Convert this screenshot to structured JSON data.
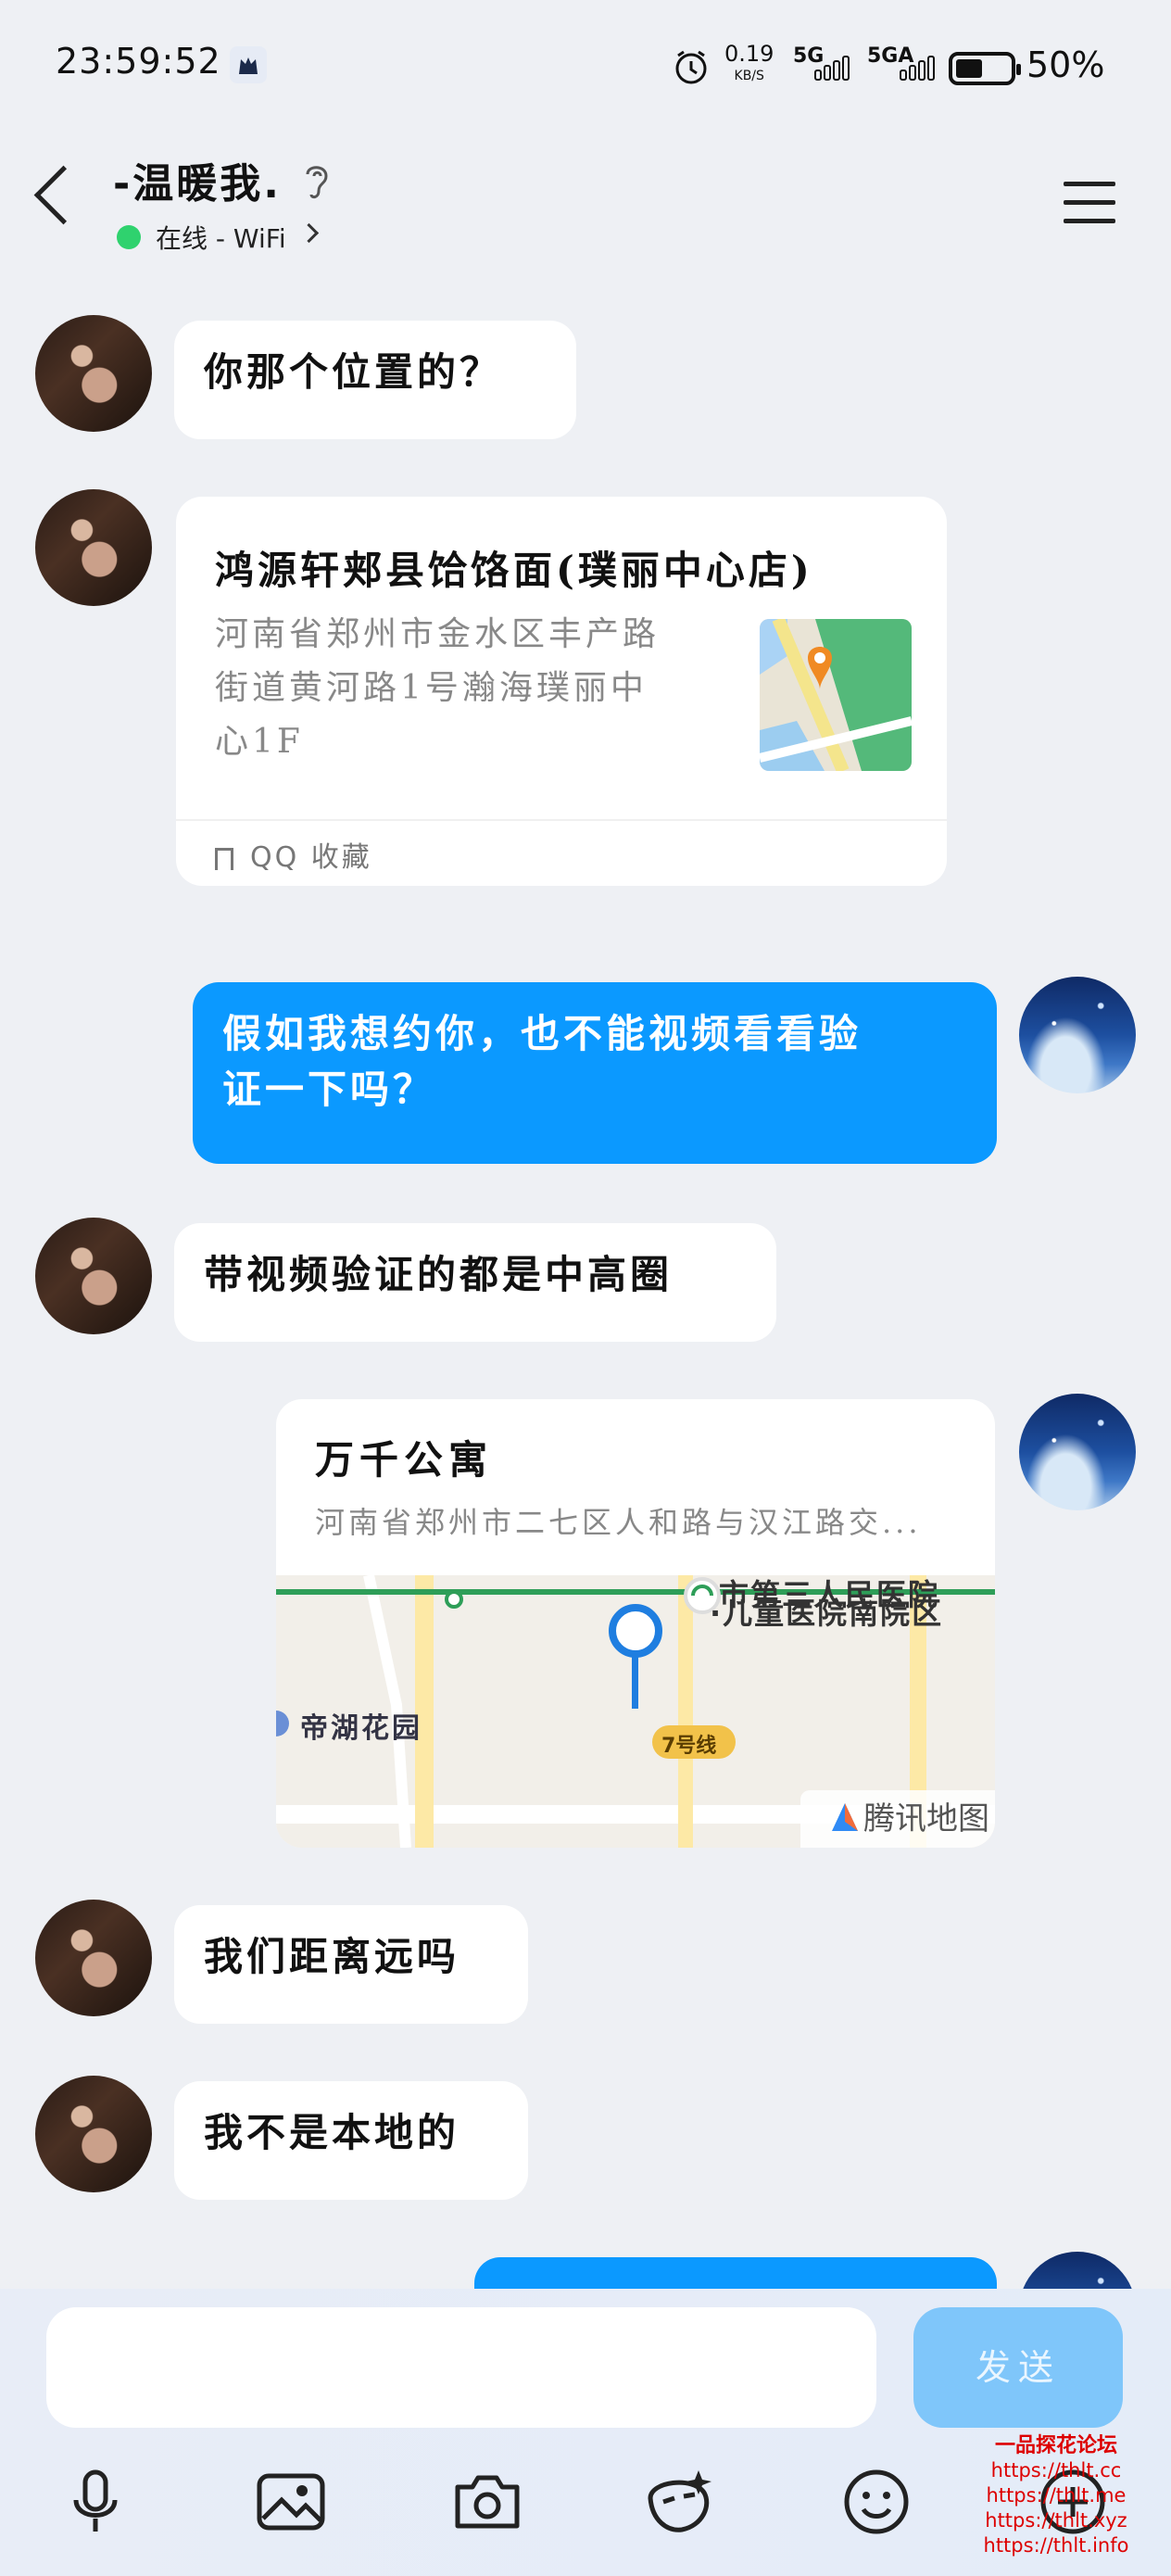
{
  "status_bar": {
    "time": "23:59:52",
    "net_speed": "0.19",
    "net_unit": "KB/S",
    "sim1": "5G",
    "sim2": "5GA",
    "battery": "50%"
  },
  "header": {
    "contact_name": "-温暖我.",
    "online_status": "在线 - WiFi"
  },
  "messages": [
    {
      "side": "them",
      "type": "text",
      "text": "你那个位置的？"
    },
    {
      "side": "them",
      "type": "location",
      "title": "鸿源轩郏县饸饹面(璞丽中心店)",
      "address_lines": [
        "河南省郑州市金水区丰产路",
        "街道黄河路1号瀚海璞丽中",
        "心1F"
      ],
      "fav_label": "QQ 收藏"
    },
    {
      "side": "me",
      "type": "text",
      "lines": [
        "假如我想约你，也不能视频看看验",
        "证一下吗？"
      ]
    },
    {
      "side": "them",
      "type": "text",
      "text": "带视频验证的都是中高圈"
    },
    {
      "side": "me",
      "type": "map",
      "title": "万千公寓",
      "address": "河南省郑州市二七区人和路与汉江路交...",
      "map_labels": {
        "hospital_top": "市第三人民医院",
        "hospital": "·儿童医院南院区",
        "garden": "帝湖花园",
        "line": "7号线",
        "provider": "腾讯地图"
      }
    },
    {
      "side": "them",
      "type": "text",
      "text": "我们距离远吗"
    },
    {
      "side": "them",
      "type": "text",
      "text": "我不是本地的"
    }
  ],
  "input_bar": {
    "send_label": "发送"
  },
  "watermark": {
    "title": "一品探花论坛",
    "lines": [
      "https://thlt.cc",
      "https://thlt.me",
      "https://thlt.xyz",
      "https://thlt.info"
    ]
  },
  "colors": {
    "accent": "#0b99ff",
    "online": "#2fd26e",
    "send_disabled": "#7fc6fa"
  }
}
